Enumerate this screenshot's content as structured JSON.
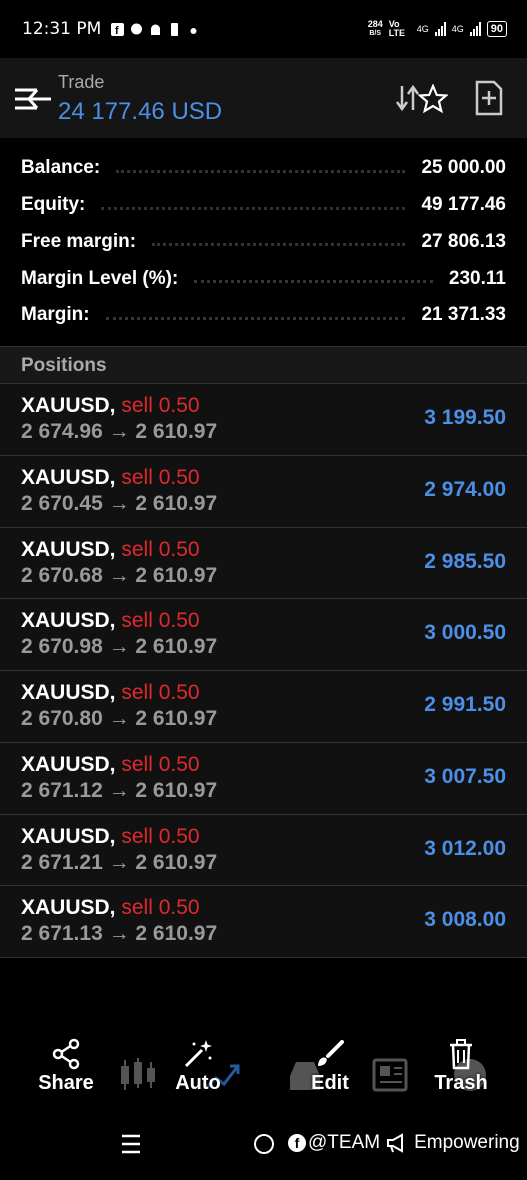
{
  "status_bar": {
    "time": "12:31 PM",
    "speed": "284",
    "speed_unit": "B/S",
    "network_1": "Vo LTE",
    "network_2": "4G",
    "network_3": "4G",
    "battery": "90"
  },
  "header": {
    "subtitle": "Trade",
    "title": "24 177.46 USD"
  },
  "summary": [
    {
      "label": "Balance:",
      "value": "25 000.00"
    },
    {
      "label": "Equity:",
      "value": "49 177.46"
    },
    {
      "label": "Free margin:",
      "value": "27 806.13"
    },
    {
      "label": "Margin Level (%):",
      "value": "230.11"
    },
    {
      "label": "Margin:",
      "value": "21 371.33"
    }
  ],
  "positions_header": "Positions",
  "positions": [
    {
      "symbol": "XAUUSD,",
      "side": "sell 0.50",
      "prices": "2 674.96 → 2 610.97",
      "profit": "3 199.50"
    },
    {
      "symbol": "XAUUSD,",
      "side": "sell 0.50",
      "prices": "2 670.45 → 2 610.97",
      "profit": "2 974.00"
    },
    {
      "symbol": "XAUUSD,",
      "side": "sell 0.50",
      "prices": "2 670.68 → 2 610.97",
      "profit": "2 985.50"
    },
    {
      "symbol": "XAUUSD,",
      "side": "sell 0.50",
      "prices": "2 670.98 → 2 610.97",
      "profit": "3 000.50"
    },
    {
      "symbol": "XAUUSD,",
      "side": "sell 0.50",
      "prices": "2 670.80 → 2 610.97",
      "profit": "2 991.50"
    },
    {
      "symbol": "XAUUSD,",
      "side": "sell 0.50",
      "prices": "2 671.12 → 2 610.97",
      "profit": "3 007.50"
    },
    {
      "symbol": "XAUUSD,",
      "side": "sell 0.50",
      "prices": "2 671.21 → 2 610.97",
      "profit": "3 012.00"
    },
    {
      "symbol": "XAUUSD,",
      "side": "sell 0.50",
      "prices": "2 671.13 → 2 610.97",
      "profit": "3 008.00"
    }
  ],
  "toolbar": {
    "share": "Share",
    "auto": "Auto",
    "edit": "Edit",
    "trash": "Trash"
  },
  "watermark": {
    "handle": "@TEAM",
    "text": "Empowering"
  },
  "colors": {
    "accent_blue": "#4c8fe6",
    "sell_red": "#e0292e",
    "background": "#111111"
  }
}
